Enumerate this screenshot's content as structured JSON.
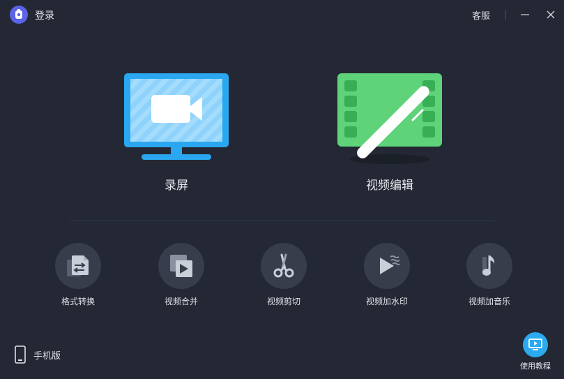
{
  "header": {
    "login_label": "登录",
    "support_label": "客服"
  },
  "features": [
    {
      "label": "录屏",
      "icon": "monitor-camera-icon",
      "color": "#2aa7f0"
    },
    {
      "label": "视频编辑",
      "icon": "film-pen-icon",
      "color": "#5ed37a"
    }
  ],
  "tools": [
    {
      "label": "格式转换",
      "icon": "format-convert-icon"
    },
    {
      "label": "视频合并",
      "icon": "video-merge-icon"
    },
    {
      "label": "视频剪切",
      "icon": "scissors-icon"
    },
    {
      "label": "视频加水印",
      "icon": "watermark-icon"
    },
    {
      "label": "视频加音乐",
      "icon": "music-note-icon"
    }
  ],
  "footer": {
    "mobile_label": "手机版",
    "tutorial_label": "使用教程"
  }
}
